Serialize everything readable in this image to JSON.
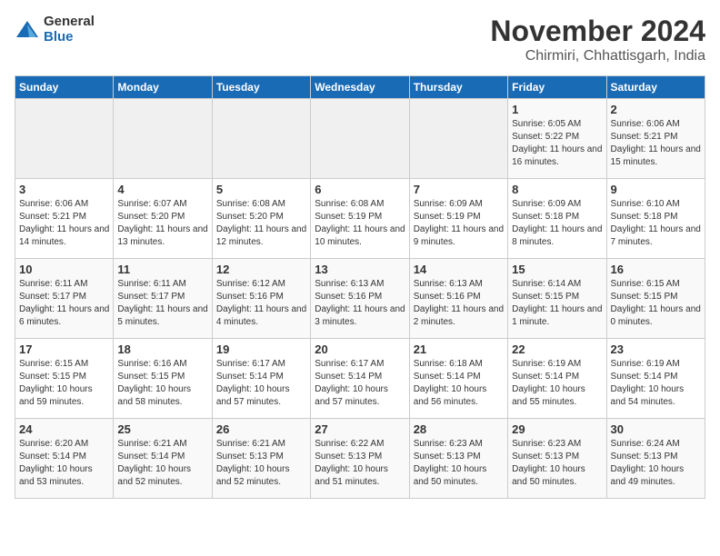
{
  "logo": {
    "general": "General",
    "blue": "Blue"
  },
  "title": {
    "month": "November 2024",
    "location": "Chirmiri, Chhattisgarh, India"
  },
  "weekdays": [
    "Sunday",
    "Monday",
    "Tuesday",
    "Wednesday",
    "Thursday",
    "Friday",
    "Saturday"
  ],
  "weeks": [
    [
      {
        "day": "",
        "info": ""
      },
      {
        "day": "",
        "info": ""
      },
      {
        "day": "",
        "info": ""
      },
      {
        "day": "",
        "info": ""
      },
      {
        "day": "",
        "info": ""
      },
      {
        "day": "1",
        "info": "Sunrise: 6:05 AM\nSunset: 5:22 PM\nDaylight: 11 hours and 16 minutes."
      },
      {
        "day": "2",
        "info": "Sunrise: 6:06 AM\nSunset: 5:21 PM\nDaylight: 11 hours and 15 minutes."
      }
    ],
    [
      {
        "day": "3",
        "info": "Sunrise: 6:06 AM\nSunset: 5:21 PM\nDaylight: 11 hours and 14 minutes."
      },
      {
        "day": "4",
        "info": "Sunrise: 6:07 AM\nSunset: 5:20 PM\nDaylight: 11 hours and 13 minutes."
      },
      {
        "day": "5",
        "info": "Sunrise: 6:08 AM\nSunset: 5:20 PM\nDaylight: 11 hours and 12 minutes."
      },
      {
        "day": "6",
        "info": "Sunrise: 6:08 AM\nSunset: 5:19 PM\nDaylight: 11 hours and 10 minutes."
      },
      {
        "day": "7",
        "info": "Sunrise: 6:09 AM\nSunset: 5:19 PM\nDaylight: 11 hours and 9 minutes."
      },
      {
        "day": "8",
        "info": "Sunrise: 6:09 AM\nSunset: 5:18 PM\nDaylight: 11 hours and 8 minutes."
      },
      {
        "day": "9",
        "info": "Sunrise: 6:10 AM\nSunset: 5:18 PM\nDaylight: 11 hours and 7 minutes."
      }
    ],
    [
      {
        "day": "10",
        "info": "Sunrise: 6:11 AM\nSunset: 5:17 PM\nDaylight: 11 hours and 6 minutes."
      },
      {
        "day": "11",
        "info": "Sunrise: 6:11 AM\nSunset: 5:17 PM\nDaylight: 11 hours and 5 minutes."
      },
      {
        "day": "12",
        "info": "Sunrise: 6:12 AM\nSunset: 5:16 PM\nDaylight: 11 hours and 4 minutes."
      },
      {
        "day": "13",
        "info": "Sunrise: 6:13 AM\nSunset: 5:16 PM\nDaylight: 11 hours and 3 minutes."
      },
      {
        "day": "14",
        "info": "Sunrise: 6:13 AM\nSunset: 5:16 PM\nDaylight: 11 hours and 2 minutes."
      },
      {
        "day": "15",
        "info": "Sunrise: 6:14 AM\nSunset: 5:15 PM\nDaylight: 11 hours and 1 minute."
      },
      {
        "day": "16",
        "info": "Sunrise: 6:15 AM\nSunset: 5:15 PM\nDaylight: 11 hours and 0 minutes."
      }
    ],
    [
      {
        "day": "17",
        "info": "Sunrise: 6:15 AM\nSunset: 5:15 PM\nDaylight: 10 hours and 59 minutes."
      },
      {
        "day": "18",
        "info": "Sunrise: 6:16 AM\nSunset: 5:15 PM\nDaylight: 10 hours and 58 minutes."
      },
      {
        "day": "19",
        "info": "Sunrise: 6:17 AM\nSunset: 5:14 PM\nDaylight: 10 hours and 57 minutes."
      },
      {
        "day": "20",
        "info": "Sunrise: 6:17 AM\nSunset: 5:14 PM\nDaylight: 10 hours and 57 minutes."
      },
      {
        "day": "21",
        "info": "Sunrise: 6:18 AM\nSunset: 5:14 PM\nDaylight: 10 hours and 56 minutes."
      },
      {
        "day": "22",
        "info": "Sunrise: 6:19 AM\nSunset: 5:14 PM\nDaylight: 10 hours and 55 minutes."
      },
      {
        "day": "23",
        "info": "Sunrise: 6:19 AM\nSunset: 5:14 PM\nDaylight: 10 hours and 54 minutes."
      }
    ],
    [
      {
        "day": "24",
        "info": "Sunrise: 6:20 AM\nSunset: 5:14 PM\nDaylight: 10 hours and 53 minutes."
      },
      {
        "day": "25",
        "info": "Sunrise: 6:21 AM\nSunset: 5:14 PM\nDaylight: 10 hours and 52 minutes."
      },
      {
        "day": "26",
        "info": "Sunrise: 6:21 AM\nSunset: 5:13 PM\nDaylight: 10 hours and 52 minutes."
      },
      {
        "day": "27",
        "info": "Sunrise: 6:22 AM\nSunset: 5:13 PM\nDaylight: 10 hours and 51 minutes."
      },
      {
        "day": "28",
        "info": "Sunrise: 6:23 AM\nSunset: 5:13 PM\nDaylight: 10 hours and 50 minutes."
      },
      {
        "day": "29",
        "info": "Sunrise: 6:23 AM\nSunset: 5:13 PM\nDaylight: 10 hours and 50 minutes."
      },
      {
        "day": "30",
        "info": "Sunrise: 6:24 AM\nSunset: 5:13 PM\nDaylight: 10 hours and 49 minutes."
      }
    ]
  ]
}
